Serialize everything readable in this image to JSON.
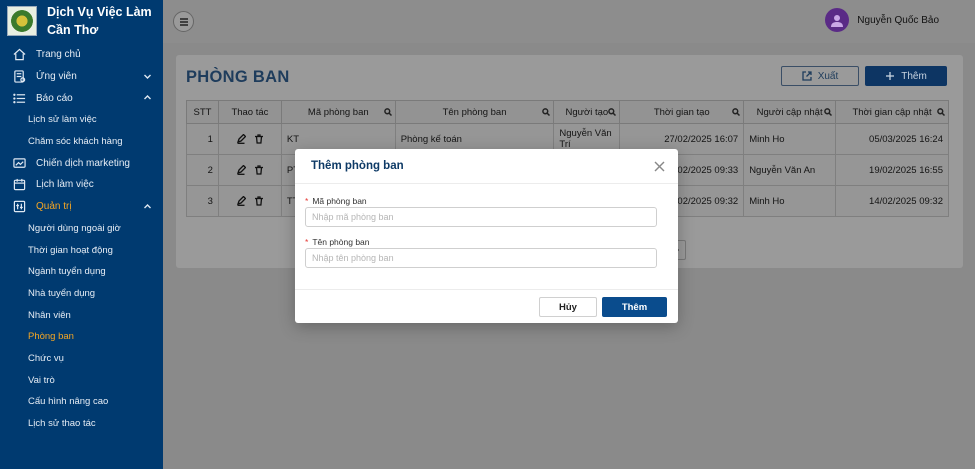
{
  "brand": {
    "title": "Dịch Vụ Việc Làm Cần Thơ"
  },
  "sidebar": {
    "items": [
      {
        "label": "Trang chủ",
        "icon": "home-icon",
        "level": "top"
      },
      {
        "label": "Ứng viên",
        "icon": "candidate-icon",
        "level": "top",
        "caret": "down"
      },
      {
        "label": "Báo cáo",
        "icon": "report-list-icon",
        "level": "top",
        "caret": "up"
      },
      {
        "label": "Lịch sử làm việc",
        "level": "sub"
      },
      {
        "label": "Chăm sóc khách hàng",
        "level": "sub"
      },
      {
        "label": "Chiến dịch marketing",
        "icon": "campaign-icon",
        "level": "top"
      },
      {
        "label": "Lịch làm việc",
        "icon": "calendar-icon",
        "level": "top"
      },
      {
        "label": "Quản trị",
        "icon": "admin-icon",
        "level": "top",
        "caret": "up",
        "active": true
      },
      {
        "label": "Người dùng ngoài giờ",
        "level": "sub"
      },
      {
        "label": "Thời gian hoạt động",
        "level": "sub"
      },
      {
        "label": "Ngành tuyển dụng",
        "level": "sub"
      },
      {
        "label": "Nhà tuyển dụng",
        "level": "sub"
      },
      {
        "label": "Nhân viên",
        "level": "sub"
      },
      {
        "label": "Phòng ban",
        "level": "sub",
        "active": true
      },
      {
        "label": "Chức vụ",
        "level": "sub"
      },
      {
        "label": "Vai trò",
        "level": "sub"
      },
      {
        "label": "Cấu hình nâng cao",
        "level": "sub"
      },
      {
        "label": "Lịch sử thao tác",
        "level": "sub"
      }
    ]
  },
  "header": {
    "user_name": "Nguyễn Quốc Bảo"
  },
  "page": {
    "title": "PHÒNG BAN",
    "export_label": "Xuất",
    "add_label": "Thêm"
  },
  "table": {
    "columns": [
      "STT",
      "Thao tác",
      "Mã phòng ban",
      "Tên phòng ban",
      "Người tạo",
      "Thời gian tạo",
      "Người cập nhật",
      "Thời gian cập nhật"
    ],
    "rows": [
      {
        "stt": "1",
        "code": "KT",
        "name": "Phòng kế toán",
        "creator": "Nguyễn Văn Trí",
        "created": "27/02/2025 16:07",
        "updater": "Minh Ho",
        "updated": "05/03/2025 16:24"
      },
      {
        "stt": "2",
        "code": "PT",
        "name": "",
        "creator": "",
        "created": "24/02/2025 09:33",
        "updater": "Nguyễn Văn An",
        "updated": "19/02/2025 16:55"
      },
      {
        "stt": "3",
        "code": "TT",
        "name": "",
        "creator": "",
        "created": "14/02/2025 09:32",
        "updater": "Minh Ho",
        "updated": "14/02/2025 09:32"
      }
    ]
  },
  "modal": {
    "title": "Thêm phòng ban",
    "code_label": "Mã phòng ban",
    "code_placeholder": "Nhập mã phòng ban",
    "name_label": "Tên phòng ban",
    "name_placeholder": "Nhập tên phòng ban",
    "cancel_label": "Hủy",
    "submit_label": "Thêm"
  },
  "colors": {
    "sidebar_bg": "#003a70",
    "active": "#f5a623",
    "primary": "#0a4c8d",
    "required": "#e53935"
  }
}
